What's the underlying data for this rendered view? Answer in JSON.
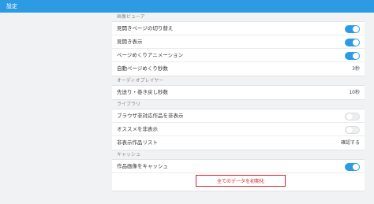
{
  "app": {
    "title": "設定"
  },
  "sections": [
    {
      "title": "画像ビューア",
      "rows": [
        {
          "label": "見開きページの切り替え",
          "control": "toggle",
          "on": true
        },
        {
          "label": "見開き表示",
          "control": "toggle",
          "on": true
        },
        {
          "label": "ページめくりアニメーション",
          "control": "toggle",
          "on": true
        },
        {
          "label": "自動ページめくり秒数",
          "control": "value",
          "value": "3秒"
        }
      ]
    },
    {
      "title": "オーディオプレイヤー",
      "rows": [
        {
          "label": "先送り・巻き戻し秒数",
          "control": "value",
          "value": "10秒"
        }
      ]
    },
    {
      "title": "ライブラリ",
      "rows": [
        {
          "label": "ブラウザ非対応作品を非表示",
          "control": "toggle",
          "on": false
        },
        {
          "label": "オススメを非表示",
          "control": "toggle",
          "on": false
        },
        {
          "label": "非表示作品リスト",
          "control": "value",
          "value": "確認する"
        }
      ]
    },
    {
      "title": "キャッシュ",
      "rows": [
        {
          "label": "作品画像をキャッシュ",
          "control": "toggle",
          "on": true
        }
      ]
    }
  ],
  "reset": {
    "label": "全てのデータを初期化"
  },
  "colors": {
    "accent": "#2d9be3",
    "danger": "#d6262d"
  }
}
